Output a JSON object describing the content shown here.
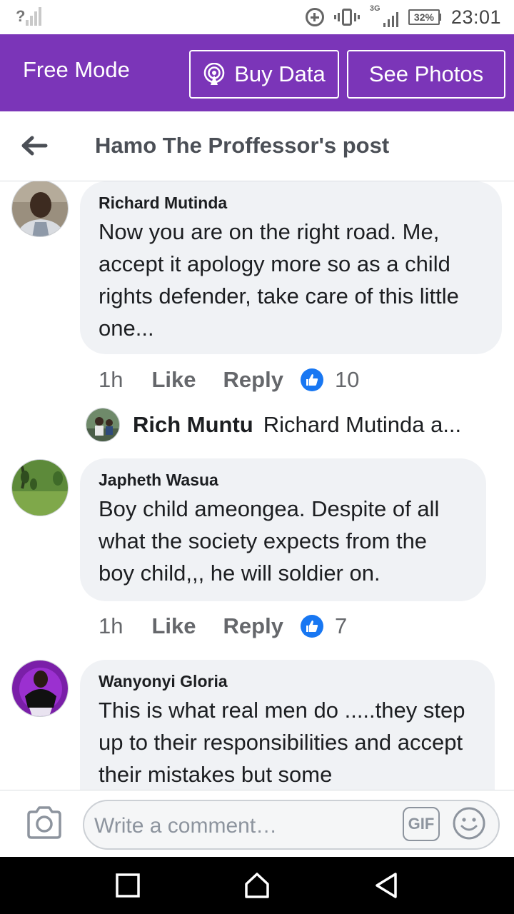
{
  "status_bar": {
    "signal_unknown": "?",
    "network_type": "3G",
    "battery": "32%",
    "time": "23:01",
    "icons": [
      "data-saver-icon",
      "vibrate-icon",
      "cell-signal-icon",
      "battery-icon"
    ]
  },
  "promo": {
    "mode_label": "Free Mode",
    "buy_data_label": "Buy Data",
    "see_photos_label": "See Photos",
    "color": "#7b35b8"
  },
  "header": {
    "title": "Hamo The Proffessor's post"
  },
  "comments": [
    {
      "author": "Richard Mutinda",
      "text": "Now you are on the right road. Me, accept it apology more so as a child rights defender, take care of this little one...",
      "time": "1h",
      "like_label": "Like",
      "reply_label": "Reply",
      "reactions": "10",
      "reply_preview": {
        "author": "Rich Muntu",
        "text": "Richard Mutinda a..."
      }
    },
    {
      "author": "Japheth Wasua",
      "text": "Boy child ameongea. Despite of all what the society expects from the boy child,,, he will soldier on.",
      "time": "1h",
      "like_label": "Like",
      "reply_label": "Reply",
      "reactions": "7"
    },
    {
      "author": "Wanyonyi Gloria",
      "text": "This is what real men do .....they step up to their responsibilities and accept their mistakes but some"
    }
  ],
  "composer": {
    "placeholder": "Write a comment…",
    "gif_label": "GIF"
  },
  "accent_colors": {
    "like_blue": "#1877f2",
    "bubble_gray": "#f0f2f5"
  }
}
